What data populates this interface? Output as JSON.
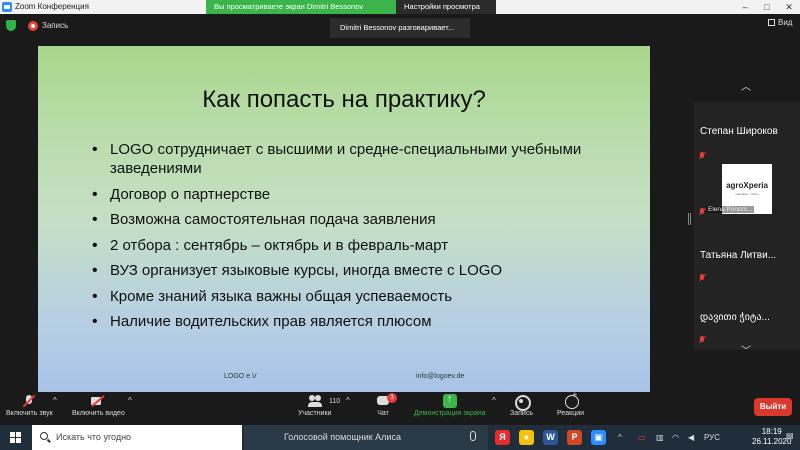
{
  "window": {
    "title": "Zoom Конференция",
    "minimize": "–",
    "maximize": "□",
    "close": "✕"
  },
  "share_banner": {
    "status": "Вы просматриваете экран Dimitri Bessonov",
    "options": "Настройки просмотра ⌄"
  },
  "topbar": {
    "recording": "Запись",
    "speaking": "Dimitri Bessonov разговаривает...",
    "view": "Вид"
  },
  "slide": {
    "title": "Как попасть на практику?",
    "bullets": [
      "LOGO сотрудничает с высшими и средне-специальными учебными заведениями",
      "Договор о партнерстве",
      "Возможна самостоятельная подача заявления",
      "2 отбора : сентябрь – октябрь  и в февраль-март",
      "ВУЗ организует языковые курсы, иногда вместе с LOGO",
      "Кроме знаний языка важны общая успеваемость",
      "Наличие водительских прав является плюсом"
    ],
    "footer_left": "LOGO e.V",
    "footer_right": "info@logoev.de"
  },
  "participants_panel": {
    "up": "︿",
    "down": "﹀",
    "tiles": [
      {
        "name": "Степан Широков"
      },
      {
        "name": "Elena Ponom...",
        "logo": "agroXperia",
        "logo_sub": "education · future"
      },
      {
        "name": "Татьяна  Литви..."
      },
      {
        "name": "დავითი ჭიტა..."
      }
    ]
  },
  "toolbar": {
    "mic": "Включить звук",
    "video": "Включить видео",
    "participants": "Участники",
    "participants_count": "110",
    "chat": "Чат",
    "chat_badge": "3",
    "share": "Демонстрация экрана",
    "record": "Запись",
    "reactions": "Реакции",
    "leave": "Выйти",
    "caret": "^"
  },
  "taskbar": {
    "search_placeholder": "Искать что угодно",
    "assistant": "Голосовой помощник Алиса",
    "language": "РУС",
    "time": "18:19",
    "date": "26.11.2020",
    "tray_arrow": "^"
  },
  "colors": {
    "share_green": "#3bb54a",
    "leave_red": "#d8382d",
    "mute_red": "#e43c3c"
  }
}
